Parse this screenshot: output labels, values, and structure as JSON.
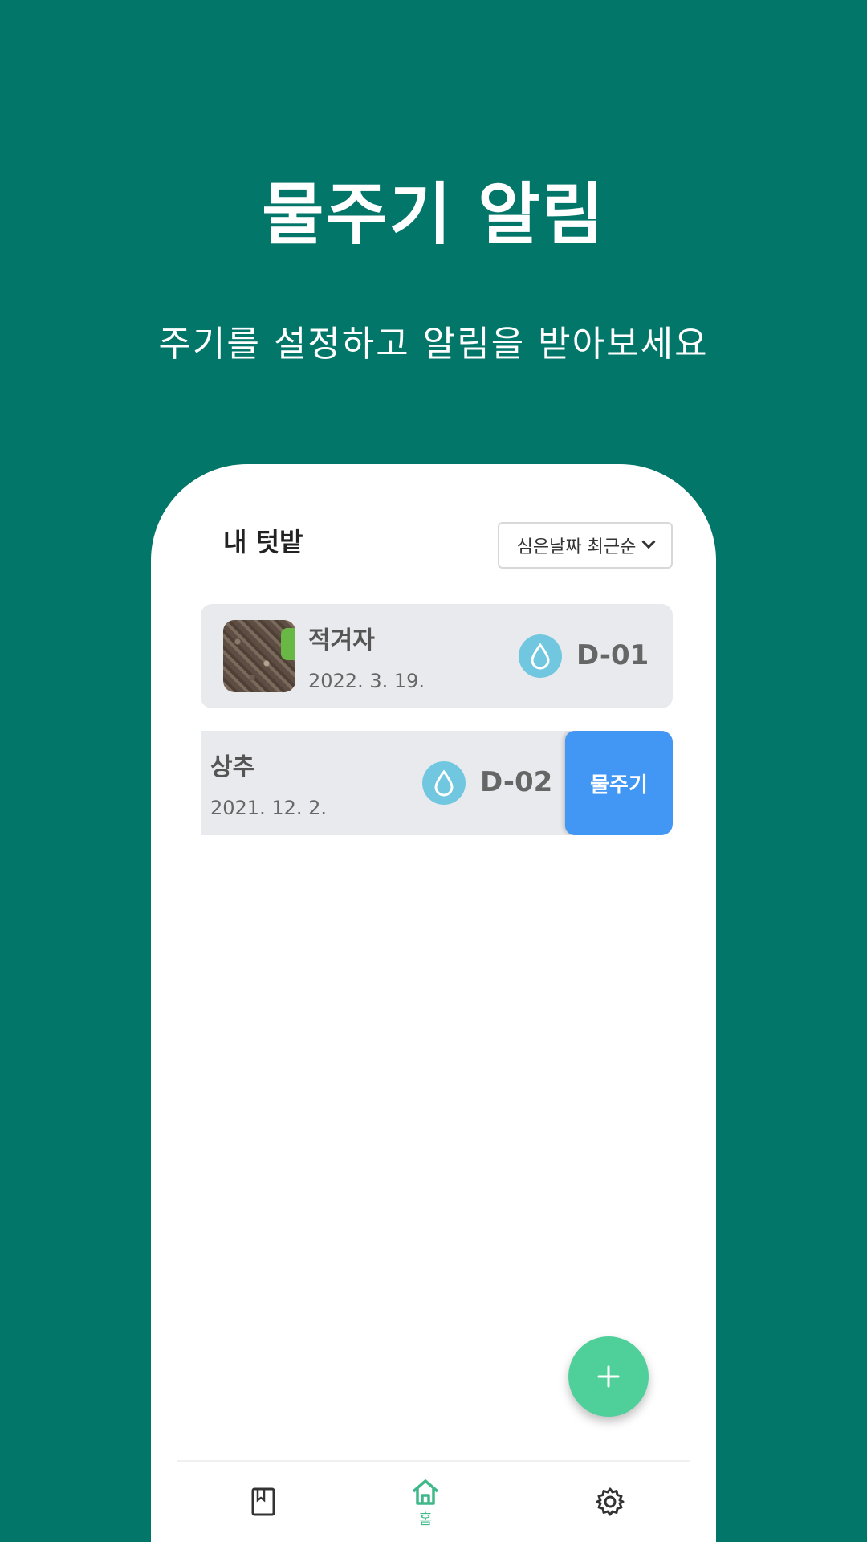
{
  "hero": {
    "title": "물주기 알림",
    "subtitle": "주기를 설정하고 알림을 받아보세요"
  },
  "app": {
    "title": "내 텃밭",
    "sort": {
      "selected": "심은날짜 최근순"
    },
    "plants": [
      {
        "name": "적겨자",
        "date": "2022. 3. 19.",
        "dday": "D-01",
        "has_photo": true
      },
      {
        "name": "상추",
        "date": "2021. 12. 2.",
        "dday": "D-02",
        "action": "물주기"
      }
    ],
    "fab_icon": "plus-icon",
    "nav": {
      "home_label": "홈",
      "items": [
        "book-icon",
        "home-icon",
        "gear-icon"
      ]
    }
  },
  "colors": {
    "background": "#03766a",
    "water_button": "#4297f5",
    "fab": "#4fd09a",
    "drop": "#71c7df",
    "nav_active": "#3fb98a"
  }
}
